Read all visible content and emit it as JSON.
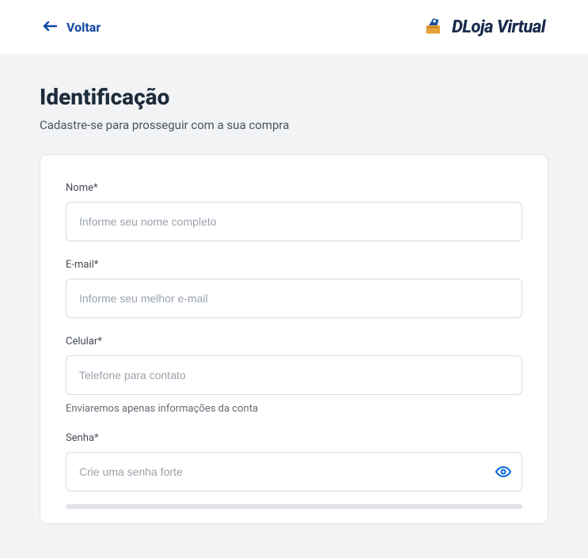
{
  "header": {
    "back_label": "Voltar",
    "brand_name": "DLoja Virtual"
  },
  "page": {
    "title": "Identificação",
    "subtitle": "Cadastre-se para prosseguir com a sua compra"
  },
  "form": {
    "name": {
      "label": "Nome*",
      "placeholder": "Informe seu nome completo",
      "value": ""
    },
    "email": {
      "label": "E-mail*",
      "placeholder": "Informe seu melhor e-mail",
      "value": ""
    },
    "phone": {
      "label": "Celular*",
      "placeholder": "Telefone para contato",
      "value": "",
      "helper": "Enviaremos apenas informações da conta"
    },
    "password": {
      "label": "Senha*",
      "placeholder": "Crie uma senha forte",
      "value": ""
    }
  },
  "colors": {
    "primary": "#0d47a1",
    "accent": "#0066e0"
  }
}
